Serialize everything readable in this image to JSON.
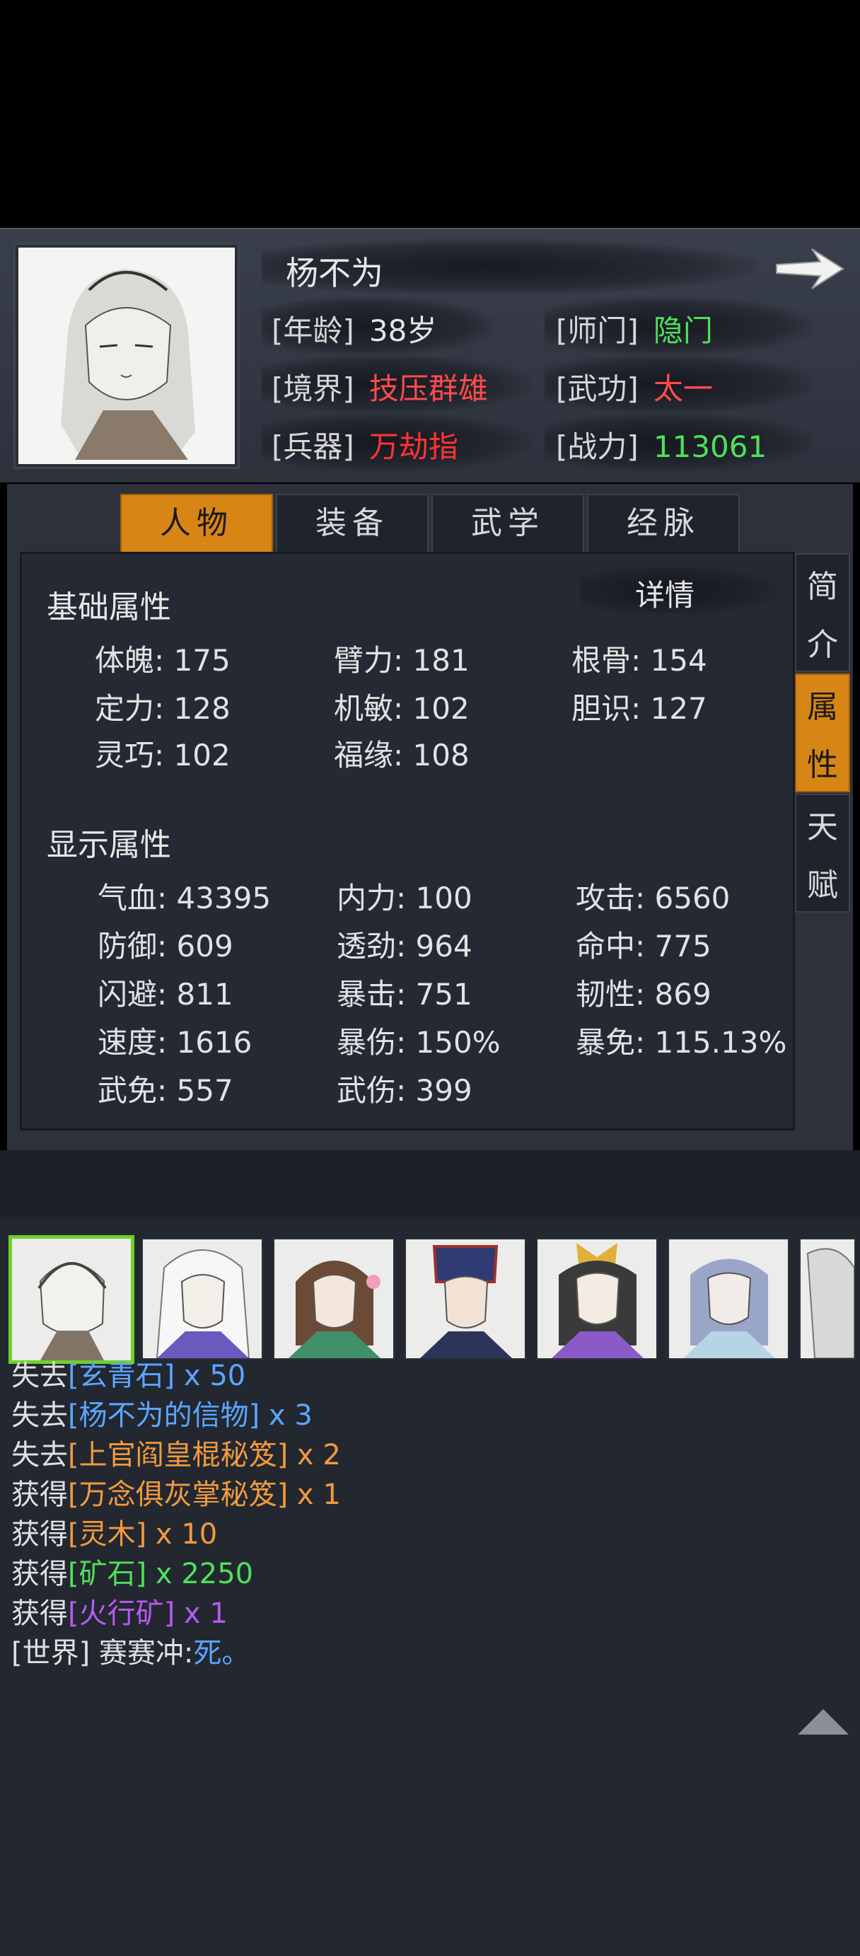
{
  "character": {
    "name": "杨不为",
    "rows": [
      {
        "label": "[年龄]",
        "value": "38岁",
        "color": "#e6e6e6"
      },
      {
        "label": "[师门]",
        "value": "隐门",
        "color": "#4fe05a"
      },
      {
        "label": "[境界]",
        "value": "技压群雄",
        "color": "#ff4b4b"
      },
      {
        "label": "[武功]",
        "value": "太一",
        "color": "#ff4b4b"
      },
      {
        "label": "[兵器]",
        "value": "万劫指",
        "color": "#ff3333"
      },
      {
        "label": "[战力]",
        "value": "113061",
        "color": "#4fe05a"
      }
    ]
  },
  "tabs": [
    "人物",
    "装备",
    "武学",
    "经脉"
  ],
  "side_tabs": [
    {
      "chars": [
        "简",
        "介"
      ]
    },
    {
      "chars": [
        "属",
        "性"
      ]
    },
    {
      "chars": [
        "天",
        "赋"
      ]
    }
  ],
  "detail_label": "详情",
  "basic": {
    "title": "基础属性",
    "stats": [
      "体魄: 175",
      "臂力: 181",
      "根骨: 154",
      "定力: 128",
      "机敏: 102",
      "胆识: 127",
      "灵巧: 102",
      "福缘: 108"
    ]
  },
  "display": {
    "title": "显示属性",
    "stats": [
      "气血: 43395",
      "内力: 100",
      "攻击: 6560",
      "防御: 609",
      "透劲: 964",
      "命中: 775",
      "闪避: 811",
      "暴击: 751",
      "韧性: 869",
      "速度: 1616",
      "暴伤: 150%",
      "暴免: 115.13%",
      "武免: 557",
      "武伤: 399"
    ]
  },
  "log": [
    {
      "prefix": "失去",
      "item": "[玄青石]",
      "qty": " x 50",
      "color": "#5aa6ff"
    },
    {
      "prefix": "失去",
      "item": "[杨不为的信物]",
      "qty": " x 3",
      "color": "#5aa6ff"
    },
    {
      "prefix": "失去",
      "item": "[上官阎皇棍秘笈]",
      "qty": " x 2",
      "color": "#f09a3e"
    },
    {
      "prefix": "获得",
      "item": "[万念俱灰掌秘笈]",
      "qty": " x 1",
      "color": "#f09a3e"
    },
    {
      "prefix": "获得",
      "item": "[灵木]",
      "qty": " x 10",
      "color": "#f09a3e"
    },
    {
      "prefix": "获得",
      "item": "[矿石]",
      "qty": " x 2250",
      "color": "#4fe05a"
    },
    {
      "prefix": "获得",
      "item": "[火行矿]",
      "qty": " x 1",
      "color": "#b45cf0"
    }
  ],
  "world_msg": {
    "channel": "[世界]",
    "speaker": " 赛赛冲:",
    "text": "死。",
    "text_color": "#5aa6ff"
  }
}
